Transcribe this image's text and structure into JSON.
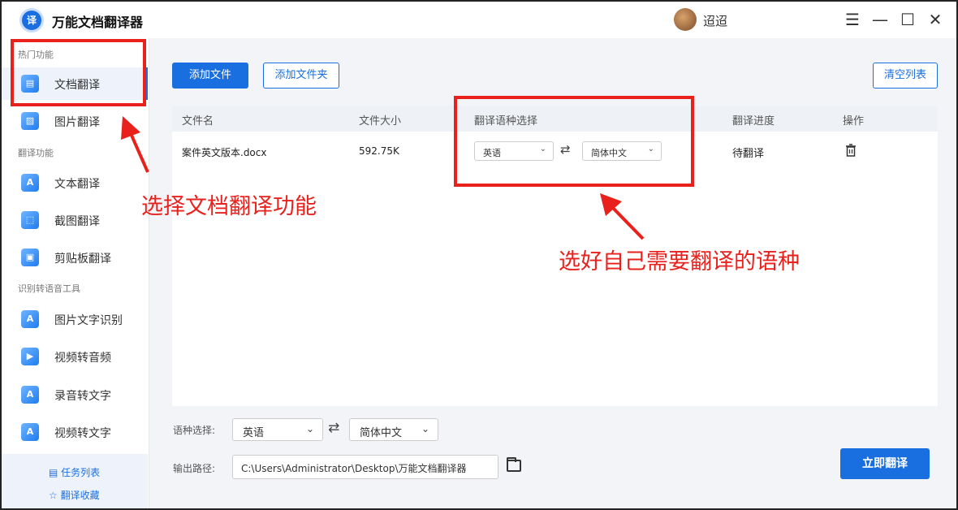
{
  "app": {
    "title": "万能文档翻译器",
    "logo_text": "译",
    "username": "迢迢"
  },
  "window": {
    "menu": "☰",
    "minimize": "—",
    "maximize": "☐",
    "close": "✕"
  },
  "sidebar": {
    "sections": [
      {
        "label": "热门功能"
      },
      {
        "label": "翻译功能"
      },
      {
        "label": "识别转语音工具"
      }
    ],
    "items": [
      {
        "label": "文档翻译",
        "icon": "doc-icon",
        "glyph": "▤"
      },
      {
        "label": "图片翻译",
        "icon": "image-icon",
        "glyph": "▨"
      },
      {
        "label": "文本翻译",
        "icon": "text-icon",
        "glyph": "A"
      },
      {
        "label": "截图翻译",
        "icon": "screenshot-icon",
        "glyph": "⬚"
      },
      {
        "label": "剪贴板翻译",
        "icon": "clipboard-icon",
        "glyph": "▣"
      },
      {
        "label": "图片文字识别",
        "icon": "ocr-icon",
        "glyph": "A"
      },
      {
        "label": "视频转音频",
        "icon": "video-audio-icon",
        "glyph": "▶"
      },
      {
        "label": "录音转文字",
        "icon": "record-icon",
        "glyph": "A"
      },
      {
        "label": "视频转文字",
        "icon": "video-text-icon",
        "glyph": "A"
      }
    ],
    "footer": [
      {
        "icon": "▤",
        "label": "任务列表"
      },
      {
        "icon": "☆",
        "label": "翻译收藏"
      }
    ]
  },
  "toolbar": {
    "add_file": "添加文件",
    "add_folder": "添加文件夹",
    "clear_list": "清空列表"
  },
  "table": {
    "headers": [
      "文件名",
      "文件大小",
      "翻译语种选择",
      "翻译进度",
      "操作"
    ],
    "rows": [
      {
        "name": "案件英文版本.docx",
        "size": "592.75K",
        "source_lang": "英语",
        "target_lang": "简体中文",
        "progress": "待翻译"
      }
    ]
  },
  "bottom": {
    "lang_label": "语种选择:",
    "source_lang": "英语",
    "target_lang": "简体中文",
    "path_label": "输出路径:",
    "path_value": "C:\\Users\\Administrator\\Desktop\\万能文档翻译器",
    "translate_button": "立即翻译"
  },
  "annotations": {
    "left_text": "选择文档翻译功能",
    "right_text": "选好自己需要翻译的语种"
  },
  "colors": {
    "accent": "#1a6fe0",
    "annotation_red": "#e8211d"
  }
}
